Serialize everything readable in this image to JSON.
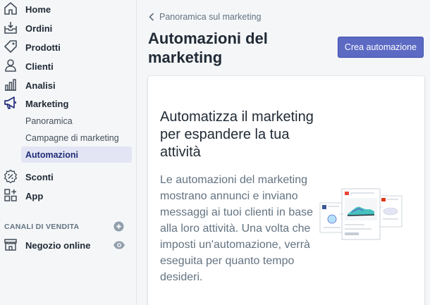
{
  "sidebar": {
    "items": [
      {
        "label": "Home",
        "icon": "home-icon"
      },
      {
        "label": "Ordini",
        "icon": "orders-icon"
      },
      {
        "label": "Prodotti",
        "icon": "tag-icon"
      },
      {
        "label": "Clienti",
        "icon": "person-icon"
      },
      {
        "label": "Analisi",
        "icon": "bar-chart-icon"
      },
      {
        "label": "Marketing",
        "icon": "megaphone-icon"
      }
    ],
    "marketing_sub": [
      {
        "label": "Panoramica",
        "active": false
      },
      {
        "label": "Campagne di marketing",
        "active": false
      },
      {
        "label": "Automazioni",
        "active": true
      }
    ],
    "items_after": [
      {
        "label": "Sconti",
        "icon": "discount-icon"
      },
      {
        "label": "App",
        "icon": "apps-icon"
      }
    ],
    "sales_channels_heading": "CANALI DI VENDITA",
    "online_store_label": "Negozio online"
  },
  "main": {
    "breadcrumb": "Panoramica sul marketing",
    "title": "Automazioni del marketing",
    "cta_label": "Crea automazione",
    "card": {
      "heading": "Automatizza il marketing per espandere la tua attività",
      "body": "Le automazioni del marketing mostrano annunci e inviano messaggi ai tuoi clienti in base alla loro attività. Una volta che imposti un'automazione, verrà eseguita per quanto tempo desideri."
    }
  },
  "colors": {
    "primary": "#5c6ac4",
    "active_bg": "#e3e5f4",
    "active_text": "#202e78",
    "sidebar_bg": "#f4f6f8"
  }
}
